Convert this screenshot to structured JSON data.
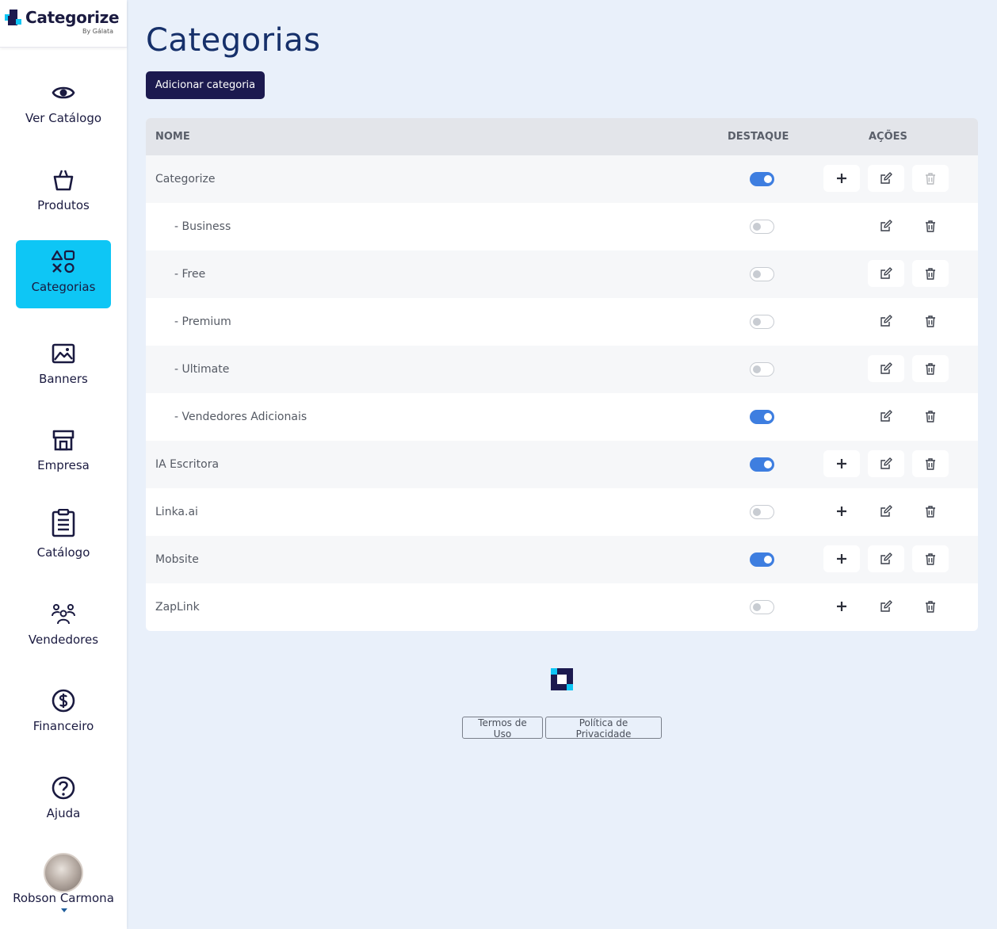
{
  "brand": {
    "name": "Categorize",
    "sub": "By Gálata"
  },
  "nav": [
    {
      "label": "Ver Catálogo"
    },
    {
      "label": "Produtos"
    },
    {
      "label": "Categorias"
    },
    {
      "label": "Banners"
    },
    {
      "label": "Empresa"
    },
    {
      "label": "Catálogo"
    },
    {
      "label": "Vendedores"
    },
    {
      "label": "Financeiro"
    },
    {
      "label": "Ajuda"
    }
  ],
  "user": {
    "name": "Robson Carmona"
  },
  "page": {
    "title": "Categorias",
    "add_label": "Adicionar categoria"
  },
  "table": {
    "headers": {
      "name": "NOME",
      "featured": "DESTAQUE",
      "actions": "AÇÕES"
    },
    "rows": [
      {
        "name": "Categorize",
        "featured": true
      },
      {
        "name": "- Business",
        "featured": false
      },
      {
        "name": "- Free",
        "featured": false
      },
      {
        "name": "- Premium",
        "featured": false
      },
      {
        "name": "- Ultimate",
        "featured": false
      },
      {
        "name": "- Vendedores Adicionais",
        "featured": true
      },
      {
        "name": "IA Escritora",
        "featured": true
      },
      {
        "name": "Linka.ai",
        "featured": false
      },
      {
        "name": "Mobsite",
        "featured": true
      },
      {
        "name": "ZapLink",
        "featured": false
      }
    ]
  },
  "footer": {
    "terms": "Termos de Uso",
    "privacy": "Política de Privacidade"
  },
  "colors": {
    "navy": "#1c1a4f",
    "accent": "#0ec6f5",
    "toggle_on": "#3e7ee0",
    "background": "#e9f0fa"
  }
}
